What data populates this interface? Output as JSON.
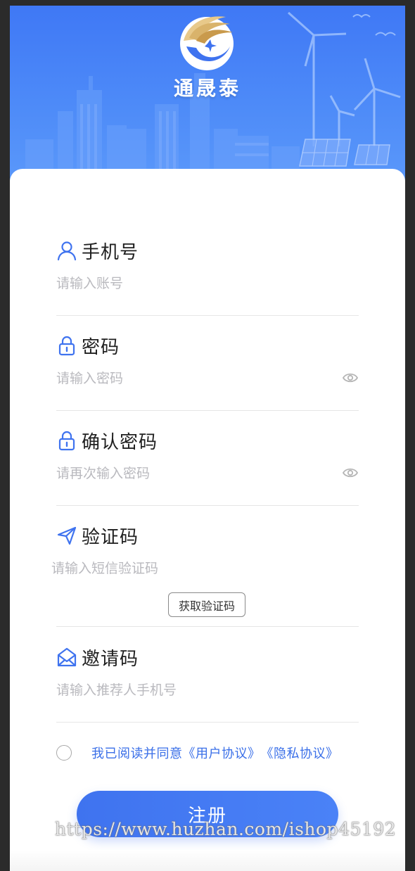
{
  "brand": {
    "name": "通晟泰"
  },
  "form": {
    "phone": {
      "label": "手机号",
      "placeholder": "请输入账号"
    },
    "password": {
      "label": "密码",
      "placeholder": "请输入密码"
    },
    "confirm": {
      "label": "确认密码",
      "placeholder": "请再次输入密码"
    },
    "code": {
      "label": "验证码",
      "placeholder": "请输入短信验证码",
      "button": "获取验证码"
    },
    "invite": {
      "label": "邀请码",
      "placeholder": "请输入推荐人手机号"
    }
  },
  "agreement": {
    "prefix": "我已阅读并同意",
    "user_agreement": "《用户协议》",
    "privacy_agreement": "《隐私协议》"
  },
  "submit_label": "注册",
  "watermark": "https://www.huzhan.com/ishop45192",
  "colors": {
    "accent": "#3f73ef",
    "link": "#3a6fe8",
    "placeholder": "#b9b9be"
  }
}
